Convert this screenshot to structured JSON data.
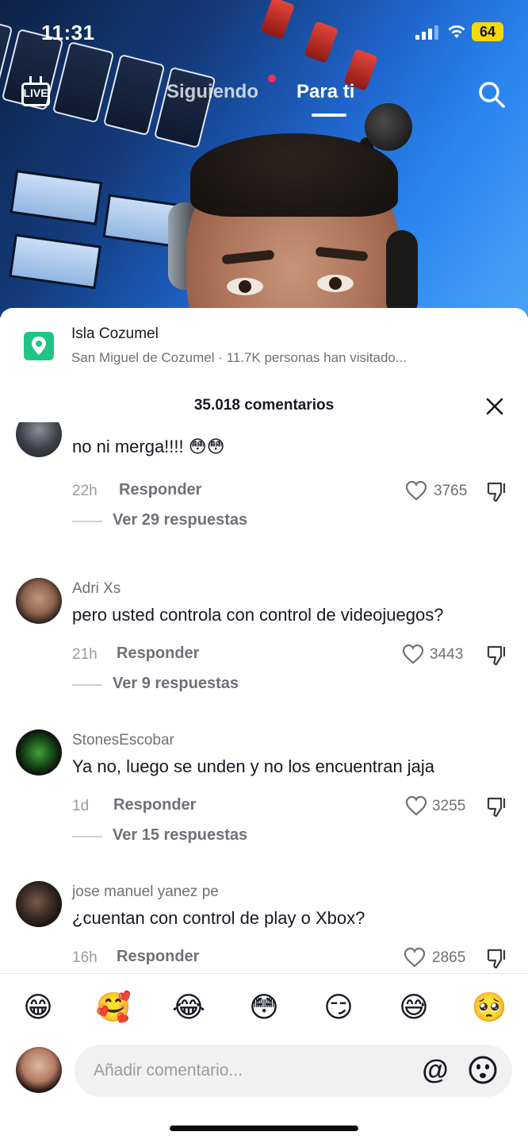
{
  "status_bar": {
    "time": "11:31",
    "battery": "64"
  },
  "top_nav": {
    "live_label": "LIVE",
    "tabs": [
      {
        "label": "Siguiendo"
      },
      {
        "label": "Para ti"
      }
    ],
    "active_tab": "Para ti",
    "colors": {
      "notification_dot": "#fe2c55"
    }
  },
  "location": {
    "name": "Isla Cozumel",
    "subtitle": "San Miguel de Cozumel · 11.7K personas han visitado...",
    "icon": "map-pin-icon",
    "colors": {
      "pin_bg": "#20c584"
    }
  },
  "comments_header": {
    "title": "35.018 comentarios"
  },
  "comments": [
    {
      "user": "",
      "text": "no ni merga!!!! 😳😳",
      "age": "22h",
      "reply": "Responder",
      "likes": "3765",
      "view_replies": "Ver 29 respuestas"
    },
    {
      "user": "Adri Xs",
      "text": "pero usted controla con control de videojuegos?",
      "age": "21h",
      "reply": "Responder",
      "likes": "3443",
      "view_replies": "Ver 9 respuestas"
    },
    {
      "user": "StonesEscobar",
      "text": "Ya no, luego se unden y no los encuentran jaja",
      "age": "1d",
      "reply": "Responder",
      "likes": "3255",
      "view_replies": "Ver 15 respuestas"
    },
    {
      "user": "jose manuel yanez pe",
      "text": "¿cuentan con control de play o Xbox?",
      "age": "16h",
      "reply": "Responder",
      "likes": "2865",
      "view_replies": ""
    }
  ],
  "emoji_bar": [
    "😁",
    "🥰",
    "😂",
    "😳",
    "😏",
    "😅",
    "🥺"
  ],
  "composer": {
    "placeholder": "Añadir comentario...",
    "mention_symbol": "@"
  }
}
